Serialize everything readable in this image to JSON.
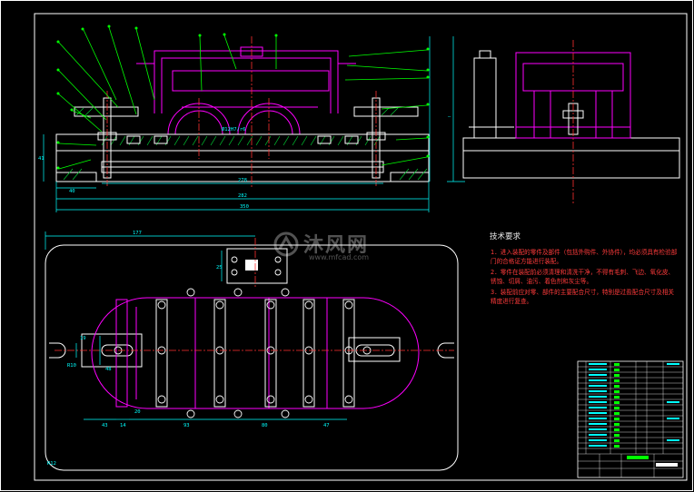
{
  "colors": {
    "background": "#000000",
    "frame": "#ffffff",
    "outline": "#ffffff",
    "part": "#ff00ff",
    "dimension": "#00ffff",
    "centerline": "#ff0000",
    "leader": "#00ff00",
    "note": "#ff3b3b"
  },
  "front_view": {
    "dims": {
      "d40": "40",
      "d41": "41",
      "d278": "278",
      "d282": "282",
      "d350": "350",
      "fit": "Ø12H7/r6"
    }
  },
  "plan_view": {
    "dims": {
      "d177": "177",
      "d43": "43",
      "d14": "14",
      "d20": "20",
      "d93": "93",
      "d80": "80",
      "d47": "47",
      "d19": "19",
      "d48": "48",
      "d25": "25",
      "r10": "R10",
      "r12": "R12"
    }
  },
  "tech_requirements": {
    "title": "技术要求",
    "items": [
      "1．进入装配的零件及部件（包括外购件、外协件），均必须具有检验部门的合格证方能进行装配。",
      "2．零件在装配前必须清理和清洗干净，不得有毛刺、飞边、氧化皮、锈蚀、切屑、油污、着色剂和灰尘等。",
      "3．装配前应对零、部件的主要配合尺寸，特别是过盈配合尺寸及相关精度进行复查。"
    ]
  },
  "watermark": {
    "main": "沐风网",
    "sub": "www.mfcad.com"
  }
}
